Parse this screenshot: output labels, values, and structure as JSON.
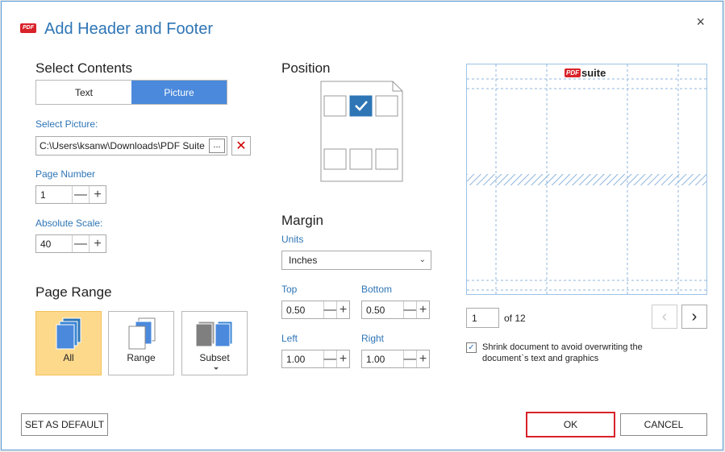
{
  "window": {
    "title": "Add Header and Footer",
    "logo_text": "PDF",
    "close_glyph": "×"
  },
  "select_contents": {
    "heading": "Select Contents",
    "tabs": [
      {
        "label": "Text",
        "active": false
      },
      {
        "label": "Picture",
        "active": true
      }
    ],
    "picture_label": "Select Picture:",
    "picture_path": "C:\\Users\\ksanw\\Downloads\\PDF Suite",
    "browse_label": "...",
    "delete_glyph": "✕",
    "page_number_label": "Page Number",
    "page_number_value": "1",
    "scale_label": "Absolute Scale:",
    "scale_value": "40",
    "minus_glyph": "—",
    "plus_glyph": "+"
  },
  "page_range": {
    "heading": "Page Range",
    "options": [
      {
        "label": "All",
        "active": true
      },
      {
        "label": "Range",
        "active": false
      },
      {
        "label": "Subset",
        "active": false
      }
    ]
  },
  "position": {
    "heading": "Position",
    "selected_cell": "top-center",
    "check_glyph": "✓"
  },
  "margin": {
    "heading": "Margin",
    "units_label": "Units",
    "units_value": "Inches",
    "chevron": "⌄",
    "top_label": "Top",
    "top_value": "0.50",
    "bottom_label": "Bottom",
    "bottom_value": "0.50",
    "left_label": "Left",
    "left_value": "1.00",
    "right_label": "Right",
    "right_value": "1.00"
  },
  "preview": {
    "logo_pdf": "PDF",
    "logo_suite": "suite",
    "page_value": "1",
    "page_of": "of 12",
    "prev_glyph": "‹",
    "next_glyph": "›",
    "shrink_checked": true,
    "shrink_text": "Shrink document to avoid overwriting the document`s text and graphics"
  },
  "footer": {
    "default_label": "SET AS DEFAULT",
    "ok_label": "OK",
    "cancel_label": "CANCEL"
  },
  "colors": {
    "accent": "#4a89dc",
    "title": "#2e75b6",
    "active_tile": "#fdd98c",
    "highlight": "#d9222a"
  }
}
